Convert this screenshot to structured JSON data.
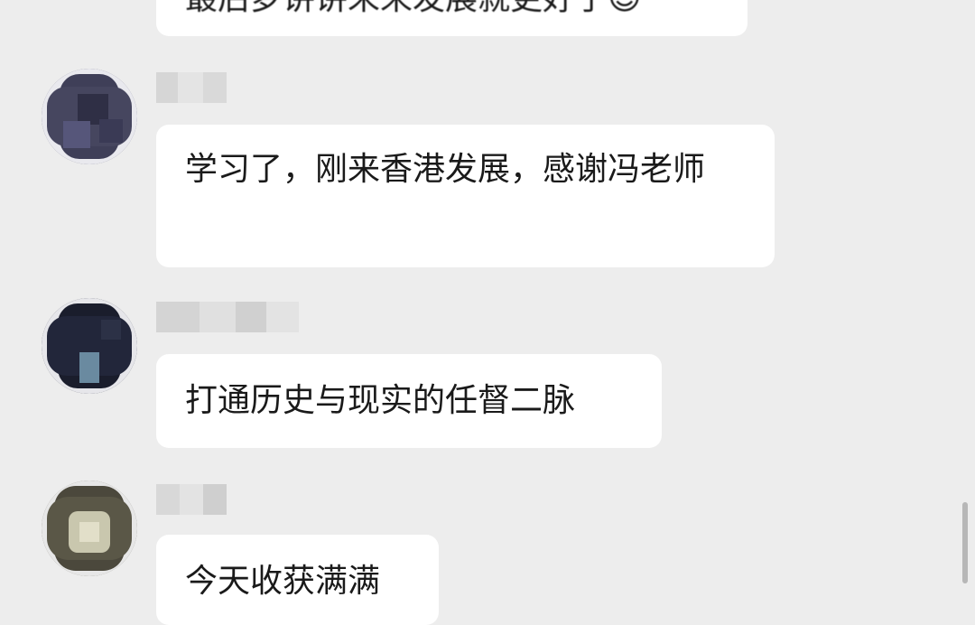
{
  "messages": [
    {
      "text": "最后梦讲讲未来发展就更好了😊"
    },
    {
      "text": "学习了，刚来香港发展，感谢冯老师"
    },
    {
      "text": "打通历史与现实的任督二脉"
    },
    {
      "text": "今天收获满满"
    }
  ],
  "colors": {
    "background": "#ededed",
    "bubble": "#ffffff",
    "text": "#1a1a1a",
    "scrollbar": "#b7b7b7"
  }
}
